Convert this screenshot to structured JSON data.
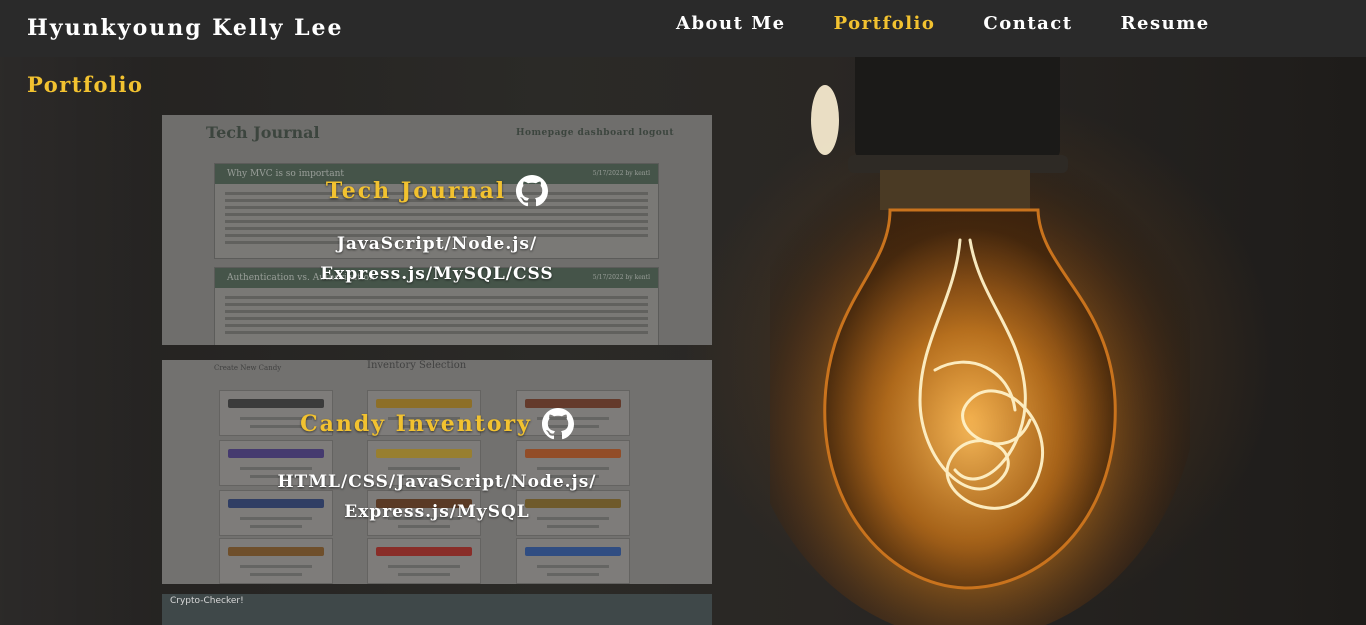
{
  "header": {
    "brand": "Hyunkyoung Kelly Lee",
    "nav": [
      {
        "label": "About Me",
        "active": false
      },
      {
        "label": "Portfolio",
        "active": true
      },
      {
        "label": "Contact",
        "active": false
      },
      {
        "label": "Resume",
        "active": false
      }
    ]
  },
  "main": {
    "section_title": "Portfolio",
    "projects": [
      {
        "title": "Tech Journal",
        "tech_line1": "JavaScript/Node.js/",
        "tech_line2": "Express.js/MySQL/CSS",
        "icon": "github-icon",
        "screenshot": {
          "heading": "Tech Journal",
          "nav": "Homepage  dashboard  logout",
          "posts": [
            "Why MVC is so important",
            "Authentication vs. Authorization"
          ],
          "post_meta": "5/17/2022 by kentl"
        }
      },
      {
        "title": "Candy Inventory",
        "tech_line1": "HTML/CSS/JavaScript/Node.js/",
        "tech_line2": "Express.js/MySQL",
        "icon": "github-icon",
        "screenshot": {
          "heading": "Inventory Selection",
          "left_label": "Create New Candy"
        }
      },
      {
        "title": "Crypto-Checker!",
        "icon": "github-icon"
      }
    ]
  },
  "colors": {
    "accent": "#f2c230",
    "nav_bg": "#2a2a2a"
  }
}
